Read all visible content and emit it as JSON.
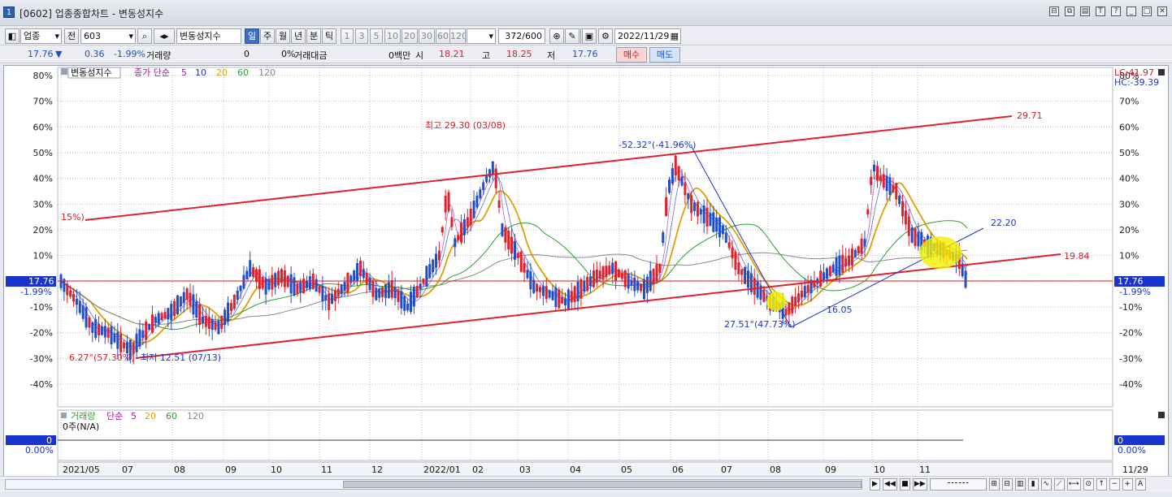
{
  "window": {
    "number": "1",
    "title": "[0602] 업종종합차트 - 변동성지수"
  },
  "toolbar": {
    "market": "업종",
    "all": "전",
    "code": "603",
    "name": "변동성지수",
    "periods": [
      "일",
      "주",
      "월",
      "년",
      "분",
      "틱"
    ],
    "active_period": "일",
    "minutes": [
      "1",
      "3",
      "5",
      "10",
      "20",
      "30",
      "60",
      "120"
    ],
    "count": "372",
    "count_total": "/600",
    "date": "2022/11/29"
  },
  "quote": {
    "price": "17.76",
    "down_arrow": "▼",
    "change": "0.36",
    "change_pct": "-1.99%",
    "volume_label": "거래량",
    "volume": "0",
    "volume_pct": "0%",
    "amount_label": "거래대금",
    "amount": "0백만",
    "open_label": "시",
    "open": "18.21",
    "high_label": "고",
    "high": "18.25",
    "low_label": "저",
    "low": "17.76",
    "buy": "매수",
    "sell": "매도"
  },
  "legend": {
    "name": "변동성지수",
    "ma_title": "종가 단순",
    "ma": [
      {
        "label": "5",
        "color": "#a020a0"
      },
      {
        "label": "10",
        "color": "#1a33cc"
      },
      {
        "label": "20",
        "color": "#e0a000"
      },
      {
        "label": "60",
        "color": "#2e9e2e"
      },
      {
        "label": "120",
        "color": "#888888"
      }
    ]
  },
  "vol_legend": {
    "name": "거래량",
    "ma_title": "단순",
    "ma": [
      {
        "label": "5",
        "color": "#a020a0"
      },
      {
        "label": "20",
        "color": "#e0a000"
      },
      {
        "label": "60",
        "color": "#2e9e2e"
      },
      {
        "label": "120",
        "color": "#888888"
      }
    ],
    "text": "0주(N/A)",
    "value_left": "0",
    "pct_left": "0.00%",
    "value_right": "0",
    "pct_right": "0.00%"
  },
  "lc_label": "LC:41.97",
  "hc_label": "HC:-39.39",
  "current_label": "17.76",
  "current_pct": "-1.99%",
  "annotations": {
    "max": "최고 29.30 (03/08)",
    "min": "최저 12.51 (07/13)",
    "pct_left": "6.27°(57.30%)",
    "ch_start": "15%)",
    "ch_top_end": "29.71",
    "ch_bot_end": "19.84",
    "diag_top": "-52.32°(-41.96%)",
    "diag_bot": "27.51°(47.73%)",
    "low_val": "16.05",
    "up_end": "22.20"
  },
  "colors": {
    "up": "#e0202a",
    "down": "#1f4fc8",
    "trend": "#e0202a",
    "blue_line": "#1a33cc"
  },
  "chart_data": {
    "type": "candlestick",
    "x_type": "date",
    "ylabel_left_unit": "%",
    "y_ticks": [
      "80%",
      "70%",
      "60%",
      "50%",
      "40%",
      "30%",
      "20%",
      "10%",
      "0%",
      "-10%",
      "-20%",
      "-30%",
      "-40%"
    ],
    "ylim_pct": [
      -40,
      80
    ],
    "x_tick_labels": [
      "2021/05",
      "07",
      "08",
      "09",
      "10",
      "11",
      "12",
      "2022/01",
      "02",
      "03",
      "04",
      "05",
      "06",
      "07",
      "08",
      "09",
      "10",
      "11"
    ],
    "x_end_label": "11/29",
    "current": 17.76,
    "series_points_pct": [
      [
        0,
        0
      ],
      [
        10,
        -8
      ],
      [
        20,
        -18
      ],
      [
        30,
        -20
      ],
      [
        40,
        -25
      ],
      [
        45,
        -27
      ],
      [
        50,
        -22
      ],
      [
        60,
        -15
      ],
      [
        70,
        -12
      ],
      [
        80,
        -5
      ],
      [
        90,
        -15
      ],
      [
        100,
        -18
      ],
      [
        110,
        -8
      ],
      [
        120,
        5
      ],
      [
        130,
        -2
      ],
      [
        140,
        2
      ],
      [
        150,
        -3
      ],
      [
        160,
        0
      ],
      [
        170,
        -8
      ],
      [
        180,
        -2
      ],
      [
        190,
        5
      ],
      [
        200,
        -5
      ],
      [
        210,
        -3
      ],
      [
        220,
        -10
      ],
      [
        230,
        0
      ],
      [
        240,
        10
      ],
      [
        245,
        35
      ],
      [
        250,
        15
      ],
      [
        260,
        25
      ],
      [
        270,
        40
      ],
      [
        275,
        45
      ],
      [
        280,
        20
      ],
      [
        290,
        10
      ],
      [
        300,
        -2
      ],
      [
        310,
        -5
      ],
      [
        320,
        -8
      ],
      [
        330,
        -3
      ],
      [
        340,
        2
      ],
      [
        350,
        5
      ],
      [
        360,
        0
      ],
      [
        370,
        -3
      ],
      [
        380,
        5
      ],
      [
        385,
        35
      ],
      [
        390,
        45
      ],
      [
        400,
        30
      ],
      [
        410,
        25
      ],
      [
        420,
        20
      ],
      [
        430,
        5
      ],
      [
        440,
        -2
      ],
      [
        450,
        -8
      ],
      [
        460,
        -12
      ],
      [
        470,
        -5
      ],
      [
        480,
        0
      ],
      [
        490,
        5
      ],
      [
        500,
        8
      ],
      [
        510,
        15
      ],
      [
        515,
        45
      ],
      [
        520,
        40
      ],
      [
        530,
        35
      ],
      [
        540,
        18
      ],
      [
        550,
        14
      ],
      [
        560,
        12
      ],
      [
        570,
        8
      ],
      [
        575,
        -1
      ]
    ],
    "ma_lines": [
      {
        "name": "20",
        "color": "#e0a000"
      },
      {
        "name": "60",
        "color": "#2e9e2e"
      },
      {
        "name": "120",
        "color": "#888888"
      }
    ],
    "trendlines": [
      {
        "name": "channel-top",
        "label": "29.71"
      },
      {
        "name": "channel-bottom",
        "label": "19.84"
      },
      {
        "name": "current-level",
        "label": "17.76"
      }
    ]
  }
}
